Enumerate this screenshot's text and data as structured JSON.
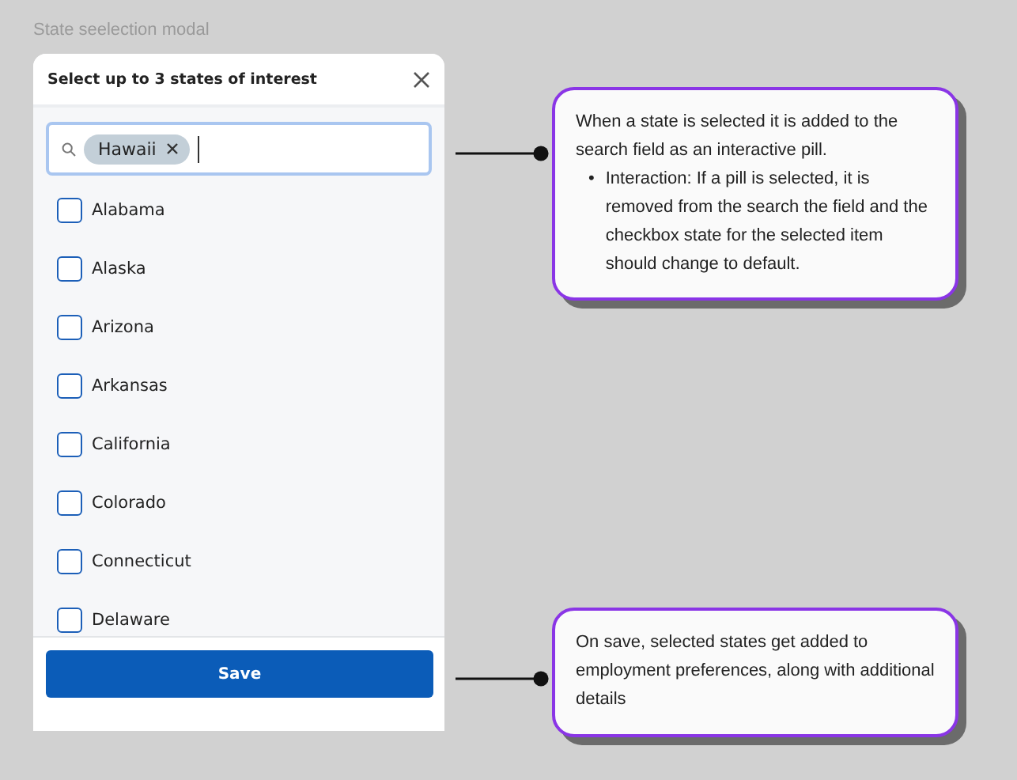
{
  "caption": "State seelection modal",
  "modal": {
    "title": "Select up to 3 states of interest",
    "search": {
      "pills": [
        {
          "label": "Hawaii"
        }
      ]
    },
    "states": [
      {
        "label": "Alabama",
        "checked": false
      },
      {
        "label": "Alaska",
        "checked": false
      },
      {
        "label": "Arizona",
        "checked": false
      },
      {
        "label": "Arkansas",
        "checked": false
      },
      {
        "label": "California",
        "checked": false
      },
      {
        "label": "Colorado",
        "checked": false
      },
      {
        "label": "Connecticut",
        "checked": false
      },
      {
        "label": "Delaware",
        "checked": false
      }
    ],
    "save_button": "Save"
  },
  "annotations": [
    {
      "text": "When a state is selected it is added to the search field as an interactive pill.",
      "bullets": [
        {
          "marker": "•",
          "text": "Interaction: If a pill is selected, it is removed from the search the field and the checkbox state for the selected item should change to default."
        }
      ]
    },
    {
      "text": "On save, selected states get added to employment preferences, along with additional details"
    }
  ]
}
